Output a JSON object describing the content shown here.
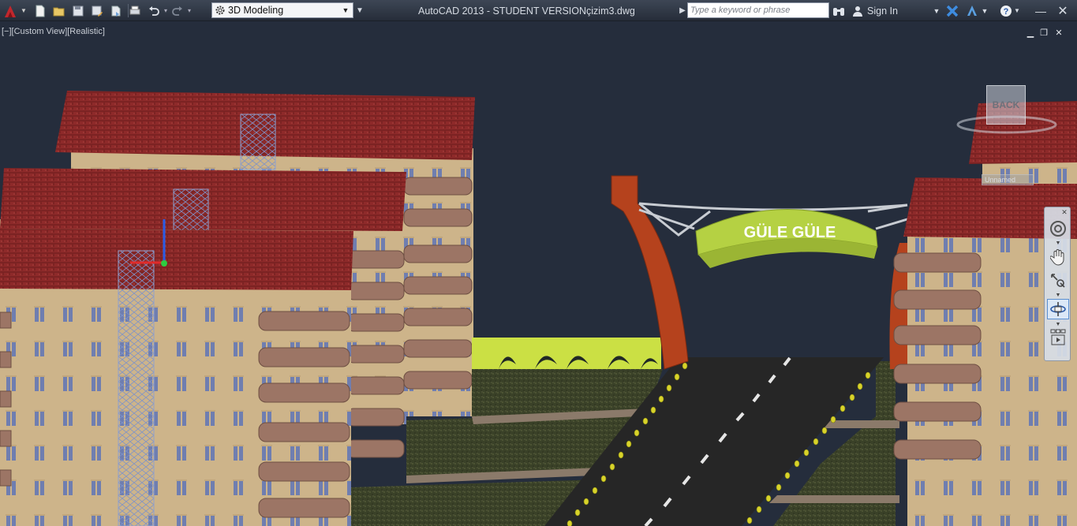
{
  "app": {
    "title": "AutoCAD 2013 - STUDENT VERSION",
    "document": "çizim3.dwg",
    "workspace": "3D Modeling",
    "search_placeholder": "Type a keyword or phrase",
    "sign_in": "Sign In"
  },
  "quick_access": [
    "new-icon",
    "open-icon",
    "save-icon",
    "save-as-icon",
    "publish-icon",
    "plot-icon",
    "undo-icon",
    "redo-icon"
  ],
  "viewport": {
    "label": "[−][Custom View][Realistic]",
    "viewcube_face": "BACK",
    "ucs_name": "Unnamed"
  },
  "scene": {
    "banner_text": "GÜLE GÜLE"
  },
  "colors": {
    "background": "#252d3c",
    "roof": "#8e2a2a",
    "facade": "#cdb48a",
    "window": "#6f7eb0",
    "balcony": "#9c7565",
    "arch_pillar": "#b5421d",
    "banner": "#b5d143",
    "road": "#262626",
    "lawn": "#3a4128",
    "fence": "#cbe044"
  }
}
